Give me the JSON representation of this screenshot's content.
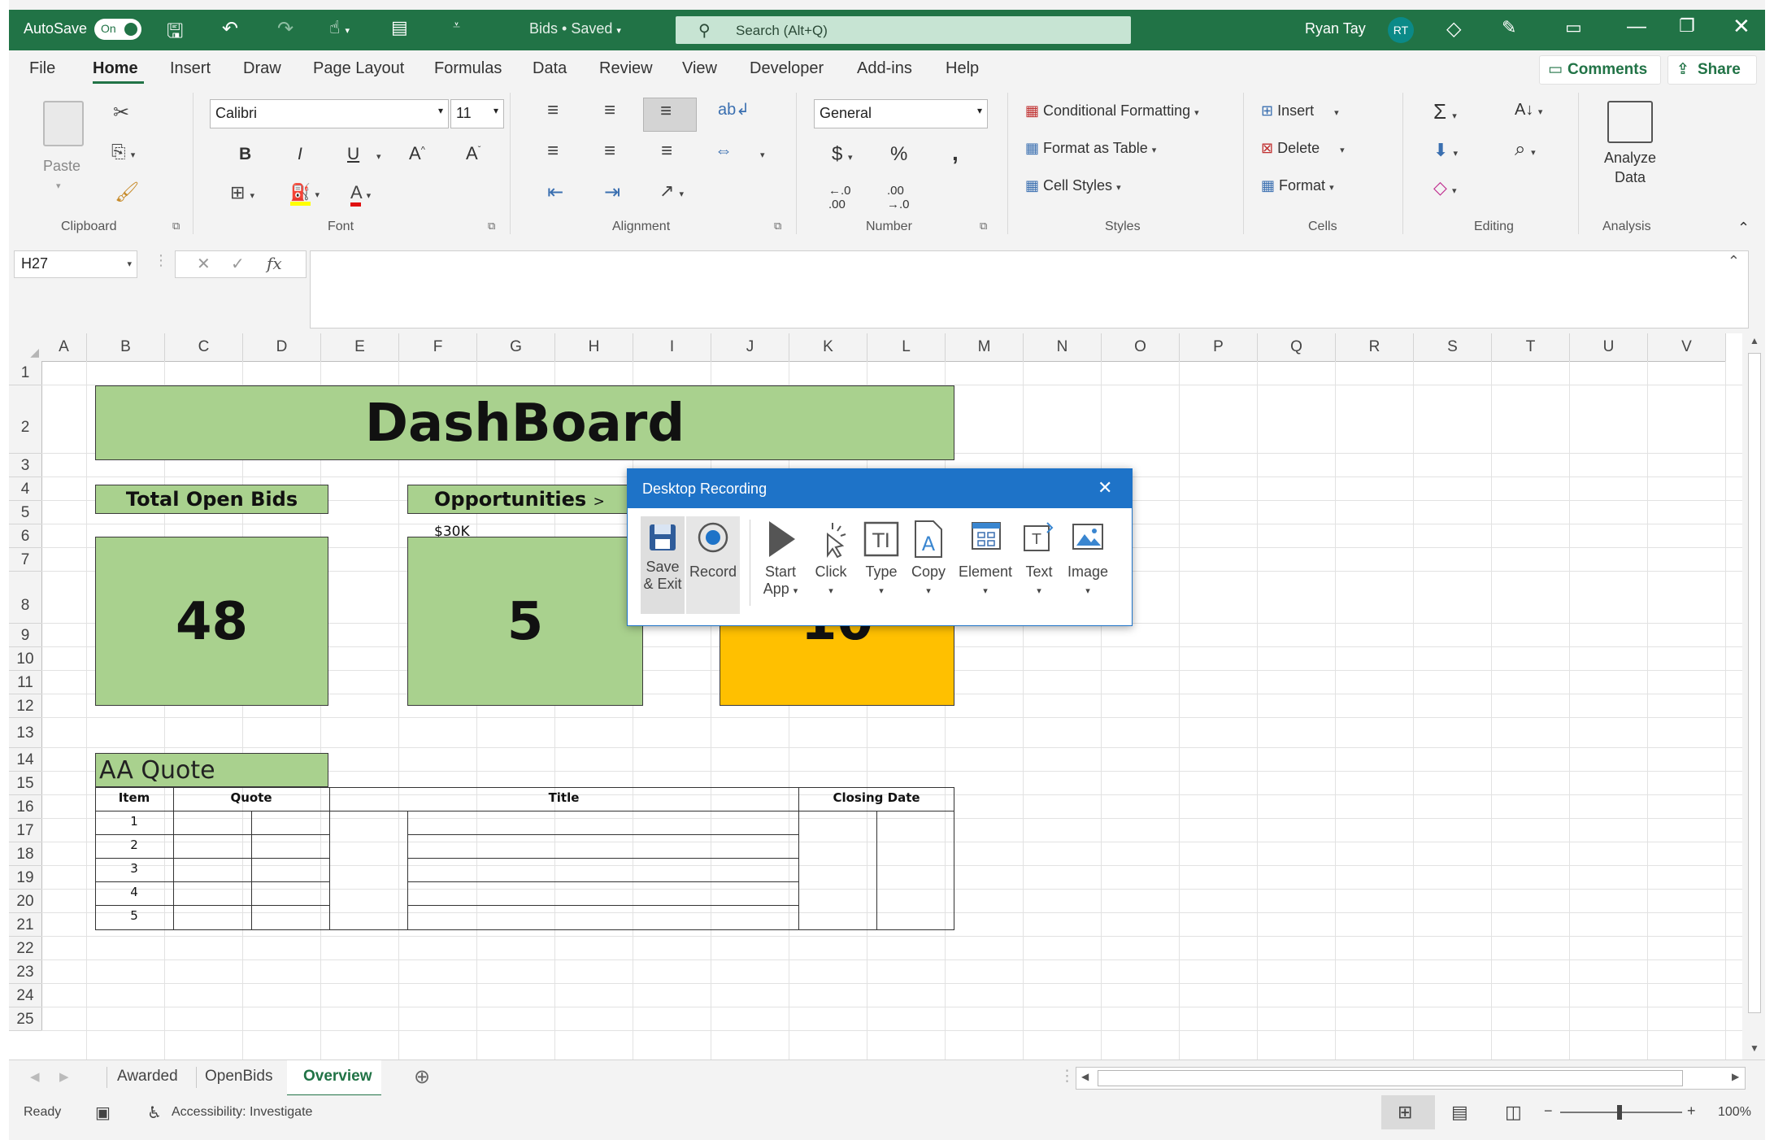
{
  "titlebar": {
    "autosave_label": "AutoSave",
    "autosave_state": "On",
    "doc_title": "Bids • Saved",
    "search_placeholder": "Search (Alt+Q)",
    "user_name": "Ryan Tay",
    "user_initials": "RT"
  },
  "menu": {
    "items": [
      "File",
      "Home",
      "Insert",
      "Draw",
      "Page Layout",
      "Formulas",
      "Data",
      "Review",
      "View",
      "Developer",
      "Add-ins",
      "Help"
    ],
    "active": "Home",
    "comments_label": "Comments",
    "share_label": "Share"
  },
  "ribbon": {
    "clipboard": {
      "paste_label": "Paste",
      "group_label": "Clipboard"
    },
    "font": {
      "font_name": "Calibri",
      "font_size": "11",
      "group_label": "Font",
      "bold": "B",
      "italic": "I",
      "underline": "U"
    },
    "alignment": {
      "group_label": "Alignment"
    },
    "number": {
      "format": "General",
      "group_label": "Number"
    },
    "styles": {
      "conditional_formatting": "Conditional Formatting",
      "format_as_table": "Format as Table",
      "cell_styles": "Cell Styles",
      "group_label": "Styles"
    },
    "cells": {
      "insert": "Insert",
      "delete": "Delete",
      "format": "Format",
      "group_label": "Cells"
    },
    "editing": {
      "group_label": "Editing"
    },
    "analysis": {
      "analyze_data": "Analyze Data",
      "analyze_line1": "Analyze",
      "analyze_line2": "Data",
      "group_label": "Analysis"
    }
  },
  "formula_bar": {
    "name_box": "H27",
    "fx": "fx",
    "formula": ""
  },
  "grid": {
    "columns": [
      "A",
      "B",
      "C",
      "D",
      "E",
      "F",
      "G",
      "H",
      "I",
      "J",
      "K",
      "L",
      "M",
      "N",
      "O",
      "P",
      "Q",
      "R",
      "S",
      "T",
      "U",
      "V"
    ],
    "rows": [
      "1",
      "2",
      "3",
      "4",
      "5",
      "6",
      "7",
      "8",
      "9",
      "10",
      "11",
      "12",
      "13",
      "14",
      "15",
      "16",
      "17",
      "18",
      "19",
      "20",
      "21",
      "22",
      "23",
      "24",
      "25"
    ]
  },
  "dashboard": {
    "title": "DashBoard",
    "total_open_bids_label": "Total Open Bids",
    "total_open_bids_value": "48",
    "opportunities_label": "Opportunities",
    "opportunities_qualifier": "> $30K",
    "opportunities_value": "5",
    "third_value": "10",
    "quote_title": "AA Quote",
    "table_headers": [
      "Item",
      "Quote",
      "Title",
      "Closing Date"
    ],
    "items": [
      "1",
      "2",
      "3",
      "4",
      "5"
    ]
  },
  "dialog": {
    "title": "Desktop Recording",
    "tools": [
      {
        "label1": "Save",
        "label2": "& Exit",
        "icon": "save-icon"
      },
      {
        "label1": "Record",
        "label2": "",
        "icon": "record-icon"
      },
      {
        "label1": "Start",
        "label2": "App",
        "icon": "play-icon"
      },
      {
        "label1": "Click",
        "label2": "",
        "icon": "click-icon"
      },
      {
        "label1": "Type",
        "label2": "",
        "icon": "type-icon"
      },
      {
        "label1": "Copy",
        "label2": "",
        "icon": "copy-icon"
      },
      {
        "label1": "Element",
        "label2": "",
        "icon": "element-icon"
      },
      {
        "label1": "Text",
        "label2": "",
        "icon": "text-icon"
      },
      {
        "label1": "Image",
        "label2": "",
        "icon": "image-icon"
      }
    ]
  },
  "sheet_tabs": {
    "tabs": [
      "Awarded",
      "OpenBids",
      "Overview"
    ],
    "active": "Overview"
  },
  "statusbar": {
    "ready": "Ready",
    "accessibility": "Accessibility: Investigate",
    "zoom": "100%"
  },
  "colors": {
    "excel_green": "#217346",
    "cell_green": "#a9d18e",
    "cell_orange": "#ffc000",
    "dialog_blue": "#1e73c8"
  }
}
